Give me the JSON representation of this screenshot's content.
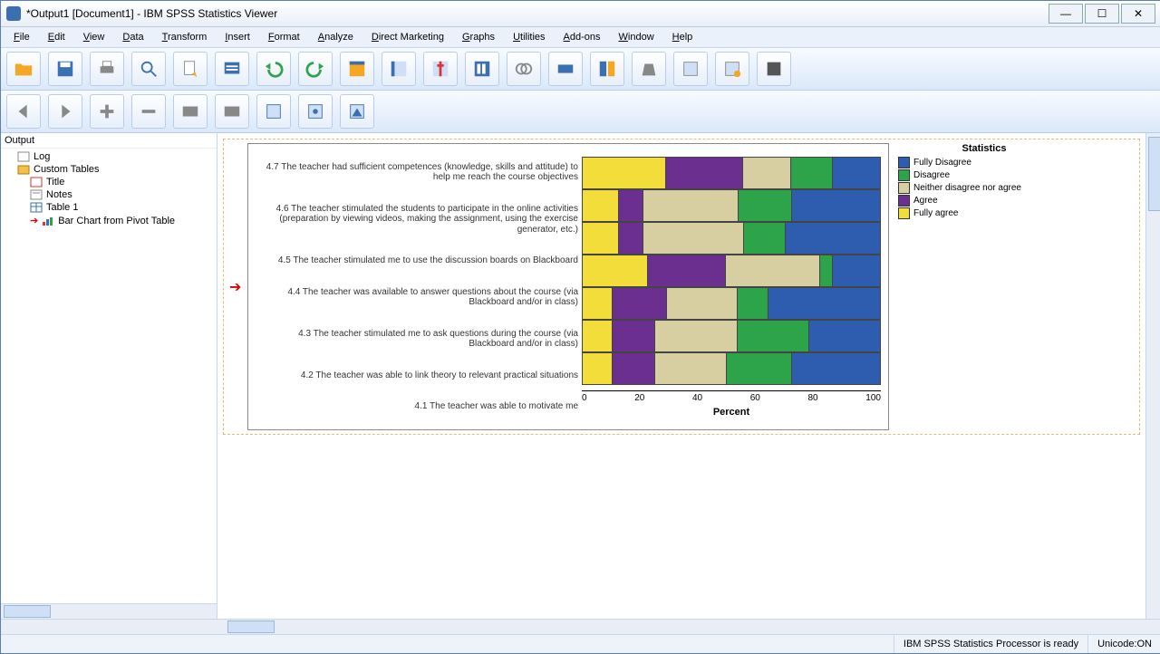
{
  "window": {
    "title": "*Output1 [Document1] - IBM SPSS Statistics Viewer"
  },
  "menus": [
    "File",
    "Edit",
    "View",
    "Data",
    "Transform",
    "Insert",
    "Format",
    "Analyze",
    "Direct Marketing",
    "Graphs",
    "Utilities",
    "Add-ons",
    "Window",
    "Help"
  ],
  "outline": {
    "head": "Output",
    "items": [
      {
        "label": "Log",
        "indent": 1,
        "icon": "log"
      },
      {
        "label": "Custom Tables",
        "indent": 1,
        "icon": "folder"
      },
      {
        "label": "Title",
        "indent": 2,
        "icon": "title"
      },
      {
        "label": "Notes",
        "indent": 2,
        "icon": "notes"
      },
      {
        "label": "Table 1",
        "indent": 2,
        "icon": "table"
      },
      {
        "label": "Bar Chart from Pivot Table",
        "indent": 2,
        "icon": "chart",
        "selected": true
      }
    ]
  },
  "legend": {
    "title": "Statistics",
    "items": [
      {
        "name": "Fully Disagree",
        "color": "#2e5db0"
      },
      {
        "name": "Disagree",
        "color": "#2da44a"
      },
      {
        "name": "Neither disagree nor agree",
        "color": "#d7cfa2"
      },
      {
        "name": "Agree",
        "color": "#6b2f8f"
      },
      {
        "name": "Fully agree",
        "color": "#f3dd3a"
      }
    ]
  },
  "status": {
    "processor": "IBM SPSS Statistics Processor is ready",
    "unicode": "Unicode:ON"
  },
  "chart_data": {
    "type": "bar",
    "orientation": "horizontal-stacked",
    "xlabel": "Percent",
    "xlim": [
      0,
      100
    ],
    "xticks": [
      0,
      20,
      40,
      60,
      80,
      100
    ],
    "series_order": [
      "Fully agree",
      "Agree",
      "Neither disagree nor agree",
      "Disagree",
      "Fully Disagree"
    ],
    "colors": {
      "Fully agree": "#f3dd3a",
      "Agree": "#6b2f8f",
      "Neither disagree nor agree": "#d7cfa2",
      "Disagree": "#2da44a",
      "Fully Disagree": "#2e5db0"
    },
    "categories": [
      "4.7 The teacher had sufficient competences (knowledge, skills and attitude) to help me reach the course objectives",
      "4.6 The teacher stimulated the students to participate in the online activities (preparation by viewing videos, making the assignment, using the exercise generator, etc.)",
      "4.5 The teacher stimulated me to use the discussion boards on Blackboard",
      "4.4 The teacher was available to answer questions about the course (via Blackboard and/or in class)",
      "4.3 The teacher stimulated me to ask questions during the course (via Blackboard and/or in class)",
      "4.2 The teacher was able to link theory to relevant practical situations",
      "4.1 The teacher was able to motivate me"
    ],
    "values": [
      {
        "Fully agree": 28,
        "Agree": 26,
        "Neither disagree nor agree": 16,
        "Disagree": 14,
        "Fully Disagree": 16
      },
      {
        "Fully agree": 12,
        "Agree": 8,
        "Neither disagree nor agree": 32,
        "Disagree": 18,
        "Fully Disagree": 30
      },
      {
        "Fully agree": 12,
        "Agree": 8,
        "Neither disagree nor agree": 34,
        "Disagree": 14,
        "Fully Disagree": 32
      },
      {
        "Fully agree": 22,
        "Agree": 26,
        "Neither disagree nor agree": 32,
        "Disagree": 4,
        "Fully Disagree": 16
      },
      {
        "Fully agree": 10,
        "Agree": 18,
        "Neither disagree nor agree": 24,
        "Disagree": 10,
        "Fully Disagree": 38
      },
      {
        "Fully agree": 10,
        "Agree": 14,
        "Neither disagree nor agree": 28,
        "Disagree": 24,
        "Fully Disagree": 24
      },
      {
        "Fully agree": 10,
        "Agree": 14,
        "Neither disagree nor agree": 24,
        "Disagree": 22,
        "Fully Disagree": 30
      }
    ]
  }
}
